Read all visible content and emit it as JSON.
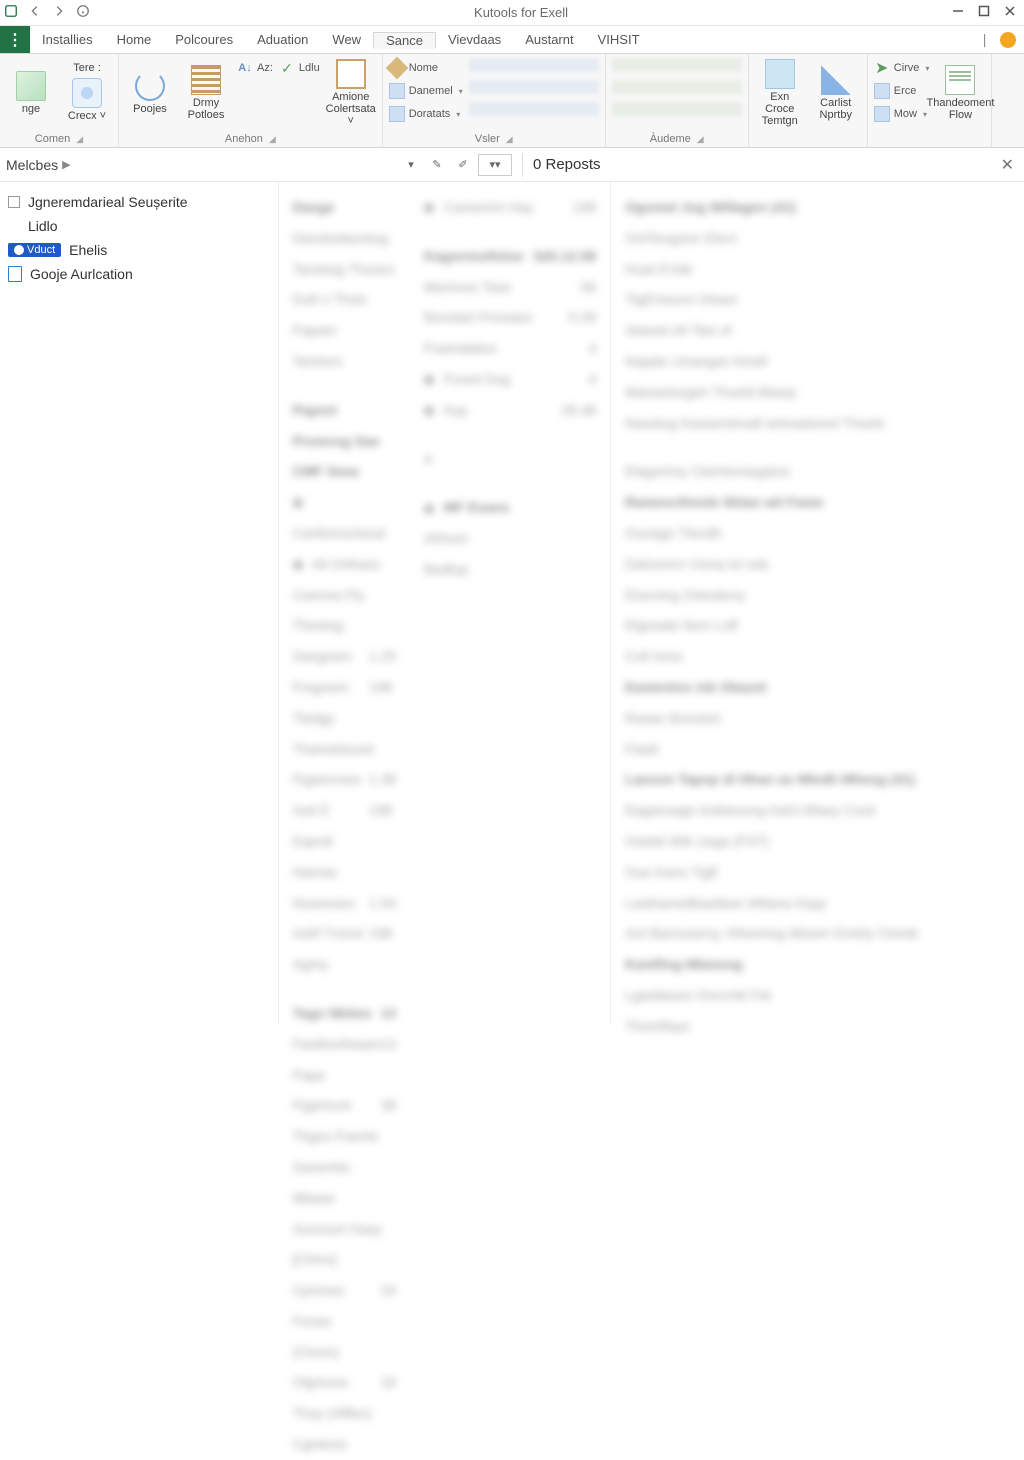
{
  "titlebar": {
    "title": "Kutools for Exell"
  },
  "tabs": [
    "Installies",
    "Home",
    "Polcoures",
    "Aduation",
    "Wew",
    "Sance",
    "Vievdaas",
    "Austarnt",
    "VIHSIT"
  ],
  "active_tab_index": 5,
  "ribbon": {
    "groups": [
      {
        "label": "Comen",
        "items": [
          {
            "type": "big",
            "label": "nge",
            "icon": "ic-doc"
          },
          {
            "type": "big",
            "label": "Crecx",
            "icon": "ic-clip",
            "dropdown": true,
            "top_label": "Tere :"
          }
        ]
      },
      {
        "label": "Anehon",
        "items": [
          {
            "type": "big",
            "label": "Poojes",
            "icon": "ic-refresh"
          },
          {
            "type": "big",
            "label": "Drmy Potloes",
            "icon": "ic-rows"
          },
          {
            "type": "stack",
            "rows": [
              {
                "label": "Az:",
                "icon": "ic-az"
              },
              {
                "label": "",
                "icon": ""
              }
            ]
          },
          {
            "type": "stack",
            "rows": [
              {
                "label": "Ldlu",
                "icon": "ic-check"
              }
            ]
          },
          {
            "type": "big",
            "label": "Amione Colertsata",
            "icon": "ic-box",
            "dropdown": true
          }
        ]
      },
      {
        "label": "Vsler",
        "items": [
          {
            "type": "stack",
            "rows": [
              {
                "label": "Nome",
                "icon": "ic-tag"
              },
              {
                "label": "Danemel",
                "icon": "ic-sm-box",
                "dropdown": true
              },
              {
                "label": "Doratats",
                "icon": "ic-sm-box",
                "dropdown": true
              }
            ]
          },
          {
            "type": "faded-block"
          }
        ]
      },
      {
        "label": "Àudeme",
        "items": [
          {
            "type": "faded-block-wide"
          }
        ]
      },
      {
        "label": "",
        "items": [
          {
            "type": "big",
            "label": "Exn Croce Temtgn",
            "icon": "ic-img"
          },
          {
            "type": "big",
            "label": "Carlist Nprtby",
            "icon": "ic-pen"
          }
        ]
      },
      {
        "label": "",
        "items": [
          {
            "type": "stack",
            "rows": [
              {
                "label": "Cirve",
                "icon": "ic-arrow",
                "dropdown": true
              },
              {
                "label": "Erce",
                "icon": "ic-sm-box"
              },
              {
                "label": "Mow",
                "icon": "ic-sm-box",
                "dropdown": true
              }
            ]
          },
          {
            "type": "big",
            "label": "Thandeoment Flow",
            "icon": "ic-sheet"
          }
        ]
      }
    ]
  },
  "secbar": {
    "breadcrumb": "Melcbes",
    "right_title": "0 Reposts"
  },
  "left_panel": {
    "items": [
      {
        "kind": "check",
        "label": "Jgneremdarieal Seușerite"
      },
      {
        "kind": "plain",
        "label": "Lidlo"
      },
      {
        "kind": "badge",
        "badge": "Vduct",
        "label": "Ehelis"
      },
      {
        "kind": "doc",
        "label": "Gooje Aurlcation"
      }
    ]
  },
  "mid_panel_blur": [
    {
      "h": true,
      "l": "Dasge",
      "r": ""
    },
    {
      "l": "Darcbodaortiog",
      "r": ""
    },
    {
      "l": "Tanstoig Thosen",
      "r": ""
    },
    {
      "l": "Duft s Thols",
      "r": ""
    },
    {
      "l": "Papam",
      "r": ""
    },
    {
      "l": "Tamtors",
      "r": ""
    },
    {
      "gap": true
    },
    {
      "h": true,
      "l": "Paport",
      "r": ""
    },
    {
      "h": true,
      "l": "Promrog Sae CMF Seas",
      "r": ""
    },
    {
      "l": "● Canfictrschesd",
      "r": ""
    },
    {
      "l": "● All Orthass",
      "r": ""
    },
    {
      "l": "Camma Fly Thestog",
      "r": ""
    },
    {
      "l": "  Sangosm Fregnem Tledgy",
      "r": "1.25 198"
    },
    {
      "l": "  Thametisond",
      "r": ""
    },
    {
      "l": "  Figamnses Aoti E Eqentt Hamas",
      "r": "1.38 198"
    },
    {
      "l": "  Nooesses Ashf Tnmol Agmy",
      "r": "1.54 198"
    },
    {
      "gap": true
    },
    {
      "h": true,
      "l": "Tago Nbites",
      "r": "13"
    },
    {
      "l": "Fardhortheam Pape",
      "r": "13"
    },
    {
      "l": "Figemunt Thgos Foents",
      "r": "38"
    },
    {
      "l": "Sanemtic Mbase",
      "r": ""
    },
    {
      "l": "Sonmort Oasy [Chins]",
      "r": ""
    },
    {
      "l": "Cpmnes Fonas (Chom)",
      "r": "24"
    },
    {
      "l": "Olgriross Thoy (Afflex)",
      "r": "18"
    },
    {
      "l": "Cgnitoss",
      "r": ""
    }
  ],
  "mid_panel_blur_r": [
    {
      "l": "● Camemm Hay",
      "r": "198"
    },
    {
      "gap": true
    },
    {
      "h": true,
      "l": "Kagormotfoloe",
      "r": "520.12.58"
    },
    {
      "l": "Memnon Tass",
      "r": "58"
    },
    {
      "l": "Bzostart Firssaes",
      "r": "0.28"
    },
    {
      "l": "Fsamatidon",
      "r": "4"
    },
    {
      "l": "● Fored Dog",
      "r": "4"
    },
    {
      "l": "● Kay",
      "r": "28.48"
    },
    {
      "gap": true
    },
    {
      "l": "4",
      "r": ""
    },
    {
      "gap": true
    },
    {
      "h": true,
      "l": "● MF Esans",
      "r": ""
    },
    {
      "l": "  Ahhum",
      "r": ""
    },
    {
      "l": "  Bedfup",
      "r": ""
    }
  ],
  "right_panel_blur": [
    {
      "h": true,
      "l": "Ogomel Jog Willagen (41)"
    },
    {
      "l": "OntTeogrion Elect"
    },
    {
      "l": "Huat EVde"
    },
    {
      "l": "TigErissoni Ulsaor"
    },
    {
      "l": "Abaset All Tais of"
    },
    {
      "l": "Napatc Unangas Kinell"
    },
    {
      "l": "Wananturgeh Thueld Bbarp"
    },
    {
      "l": "Nasetug Kasserstroall antraatsmol Thoels"
    },
    {
      "gap": true
    },
    {
      "l": "Elagomny Clamtoroegatus"
    },
    {
      "h": true,
      "l": "Ramescthesle Ithlan wil Fame"
    },
    {
      "l": "Ounagn Tlendh"
    },
    {
      "l": "Dafcemrn Visnq ist nds"
    },
    {
      "l": "Elzening Orlestlony"
    },
    {
      "l": "Elgosate fann Loff"
    },
    {
      "l": "Coll Isms"
    },
    {
      "h": true,
      "l": "Eastentos ink Obazet"
    },
    {
      "l": "Rasan Bometct"
    },
    {
      "l": "Fiastl"
    },
    {
      "h": true,
      "l": "Laeson Tapop di Hhan as Mledh Mhesg (41)"
    },
    {
      "l": "Eagansagn Anbiesung AstO.Mlasy Cock"
    },
    {
      "l": "Ostekt Wik Usga (FST)"
    },
    {
      "l": "Oue Kans Tigft"
    },
    {
      "l": "Lasthametlbastbee Wttana Kspy"
    },
    {
      "l": "Ant Barnssemy, Klheming Misem Emtrly Clomb"
    },
    {
      "h": true,
      "l": "Kantfing Mlaneog"
    },
    {
      "l": "Lgastlases Onccrlel Fal"
    },
    {
      "l": "Thomflays"
    }
  ]
}
